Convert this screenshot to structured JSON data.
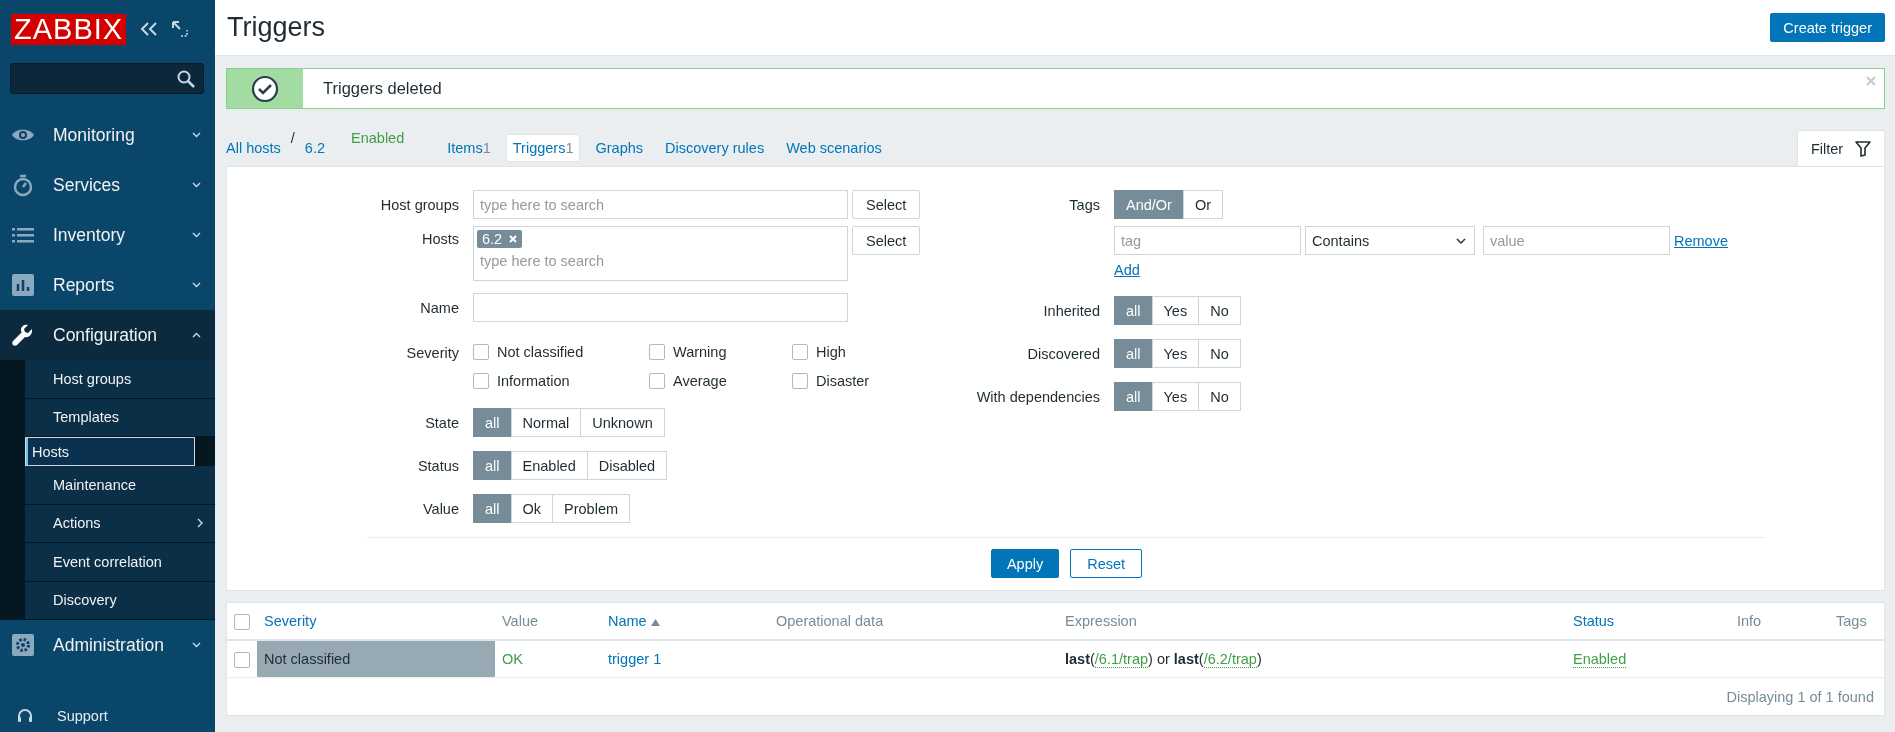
{
  "sidebar": {
    "logo": "ZABBIX",
    "items": [
      {
        "label": "Monitoring",
        "expanded": false
      },
      {
        "label": "Services",
        "expanded": false
      },
      {
        "label": "Inventory",
        "expanded": false
      },
      {
        "label": "Reports",
        "expanded": false
      },
      {
        "label": "Configuration",
        "expanded": true,
        "children": [
          {
            "label": "Host groups",
            "selected": false,
            "has_submenu": false
          },
          {
            "label": "Templates",
            "selected": false,
            "has_submenu": false
          },
          {
            "label": "Hosts",
            "selected": true,
            "has_submenu": false
          },
          {
            "label": "Maintenance",
            "selected": false,
            "has_submenu": false
          },
          {
            "label": "Actions",
            "selected": false,
            "has_submenu": true
          },
          {
            "label": "Event correlation",
            "selected": false,
            "has_submenu": false
          },
          {
            "label": "Discovery",
            "selected": false,
            "has_submenu": false
          }
        ]
      },
      {
        "label": "Administration",
        "expanded": false
      }
    ],
    "support": "Support"
  },
  "header": {
    "title": "Triggers",
    "button": "Create trigger"
  },
  "message": {
    "kind": "success",
    "text": "Triggers deleted"
  },
  "breadcrumbs": {
    "all_hosts": "All hosts",
    "separator": "/",
    "host": "6.2",
    "status": "Enabled",
    "tabs": [
      {
        "label": "Items",
        "count": "1",
        "selected": false
      },
      {
        "label": "Triggers",
        "count": "1",
        "selected": true
      },
      {
        "label": "Graphs",
        "selected": false
      },
      {
        "label": "Discovery rules",
        "selected": false
      },
      {
        "label": "Web scenarios",
        "selected": false
      }
    ]
  },
  "filter_tab": "Filter",
  "filter": {
    "host_groups": {
      "label": "Host groups",
      "placeholder": "type here to search",
      "button": "Select"
    },
    "hosts": {
      "label": "Hosts",
      "chips": [
        "6.2"
      ],
      "placeholder": "type here to search",
      "button": "Select"
    },
    "name": {
      "label": "Name"
    },
    "severity": {
      "label": "Severity",
      "options": [
        {
          "label": "Not classified",
          "checked": false
        },
        {
          "label": "Warning",
          "checked": false
        },
        {
          "label": "High",
          "checked": false
        },
        {
          "label": "Information",
          "checked": false
        },
        {
          "label": "Average",
          "checked": false
        },
        {
          "label": "Disaster",
          "checked": false
        }
      ]
    },
    "left_radios": [
      {
        "label": "State",
        "options": [
          {
            "label": "all",
            "selected": true
          },
          {
            "label": "Normal",
            "selected": false
          },
          {
            "label": "Unknown",
            "selected": false
          }
        ]
      },
      {
        "label": "Status",
        "options": [
          {
            "label": "all",
            "selected": true
          },
          {
            "label": "Enabled",
            "selected": false
          },
          {
            "label": "Disabled",
            "selected": false
          }
        ]
      },
      {
        "label": "Value",
        "options": [
          {
            "label": "all",
            "selected": true
          },
          {
            "label": "Ok",
            "selected": false
          },
          {
            "label": "Problem",
            "selected": false
          }
        ]
      }
    ],
    "tags": {
      "label": "Tags",
      "options": [
        {
          "label": "And/Or",
          "selected": true
        },
        {
          "label": "Or",
          "selected": false
        }
      ],
      "rows": [
        {
          "tag_placeholder": "tag",
          "operator": "Contains",
          "value_placeholder": "value",
          "remove": "Remove"
        }
      ],
      "add": "Add"
    },
    "right_radios": [
      {
        "label": "Inherited",
        "options": [
          {
            "label": "all",
            "selected": true
          },
          {
            "label": "Yes",
            "selected": false
          },
          {
            "label": "No",
            "selected": false
          }
        ]
      },
      {
        "label": "Discovered",
        "options": [
          {
            "label": "all",
            "selected": true
          },
          {
            "label": "Yes",
            "selected": false
          },
          {
            "label": "No",
            "selected": false
          }
        ]
      },
      {
        "label": "With dependencies",
        "options": [
          {
            "label": "all",
            "selected": true
          },
          {
            "label": "Yes",
            "selected": false
          },
          {
            "label": "No",
            "selected": false
          }
        ]
      }
    ],
    "apply": "Apply",
    "reset": "Reset"
  },
  "table": {
    "all_checked": false,
    "columns": [
      {
        "label": "Severity",
        "kind": "link",
        "sorted": false
      },
      {
        "label": "Value",
        "kind": "plain",
        "sorted": false
      },
      {
        "label": "Name",
        "kind": "link",
        "sorted": true
      },
      {
        "label": "Operational data",
        "kind": "plain",
        "sorted": false
      },
      {
        "label": "Expression",
        "kind": "plain",
        "sorted": false
      },
      {
        "label": "Status",
        "kind": "link",
        "sorted": false
      },
      {
        "label": "Info",
        "kind": "plain",
        "sorted": false
      },
      {
        "label": "Tags",
        "kind": "plain",
        "sorted": false
      }
    ],
    "rows": [
      {
        "checked": false,
        "severity": "Not classified",
        "color": "#97aab3",
        "value": "OK",
        "name": "trigger 1",
        "expression": [
          {
            "kind": "func",
            "text": "last"
          },
          {
            "kind": "plain",
            "text": "("
          },
          {
            "kind": "item",
            "text": "/6.1/trap"
          },
          {
            "kind": "plain",
            "text": ") or "
          },
          {
            "kind": "func",
            "text": "last"
          },
          {
            "kind": "plain",
            "text": "("
          },
          {
            "kind": "item",
            "text": "/6.2/trap"
          },
          {
            "kind": "plain",
            "text": ")"
          }
        ],
        "status": "Enabled"
      }
    ],
    "footer": "Displaying 1 of 1 found"
  }
}
